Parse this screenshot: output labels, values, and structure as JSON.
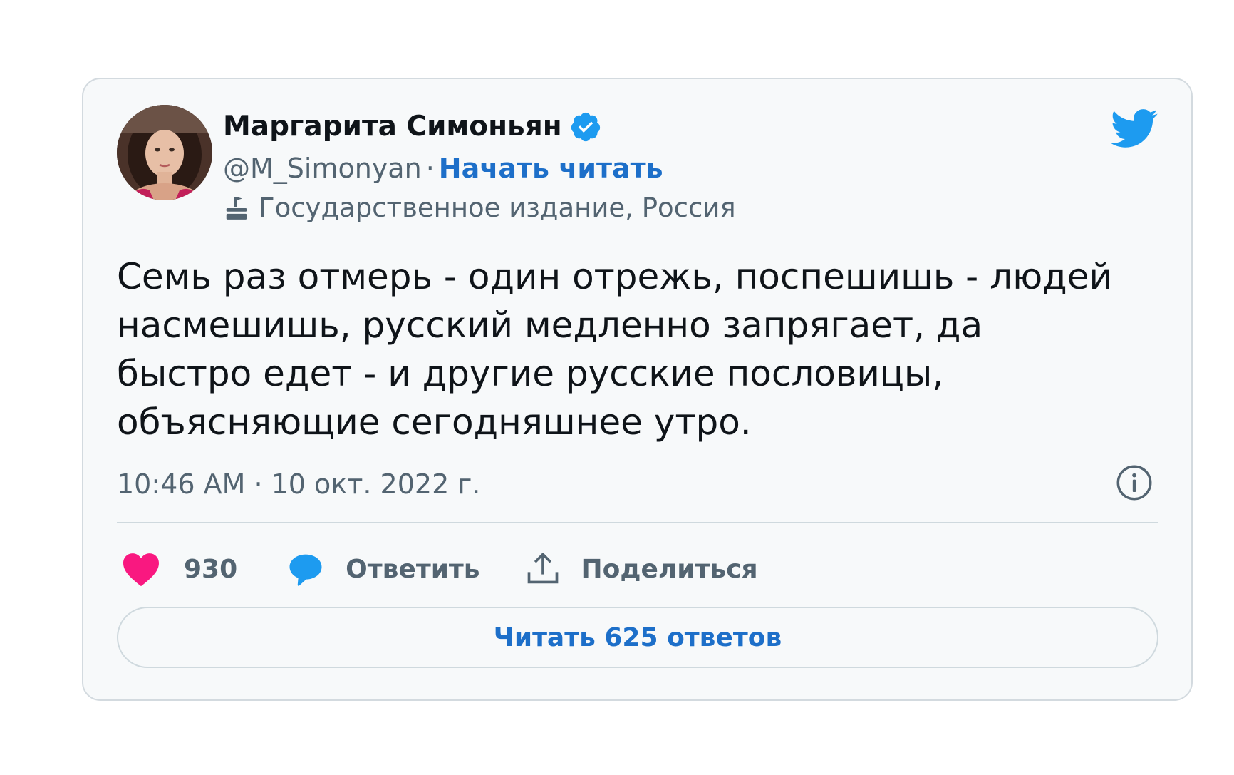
{
  "author": {
    "name": "Маргарита Симоньян",
    "handle": "@M_Simonyan",
    "separator": "·",
    "follow_label": "Начать читать",
    "account_label": "Государственное издание, Россия",
    "verified": true
  },
  "tweet": {
    "text": "Семь раз отмерь - один отрежь, поспешишь - людей насмешишь, русский медленно запрягает, да быстро едет - и другие русские пословицы, объясняющие сегодняшнее утро.",
    "timestamp": "10:46 AM · 10 окт. 2022 г."
  },
  "actions": {
    "like_count": "930",
    "reply_label": "Ответить",
    "share_label": "Поделиться"
  },
  "footer": {
    "read_replies_label": "Читать 625 ответов"
  },
  "icons": {
    "verified": "verified-badge-icon",
    "gov_label": "government-label-icon",
    "brand": "twitter-bird-icon",
    "info": "info-icon",
    "like": "heart-icon",
    "reply": "speech-bubble-icon",
    "share": "share-upload-icon"
  },
  "colors": {
    "brand_blue": "#1d9bf0",
    "link_blue": "#1d6fc9",
    "like_pink": "#f91880",
    "muted_text": "#536471",
    "card_background": "#f7f9fa",
    "border": "#cfd9de"
  }
}
